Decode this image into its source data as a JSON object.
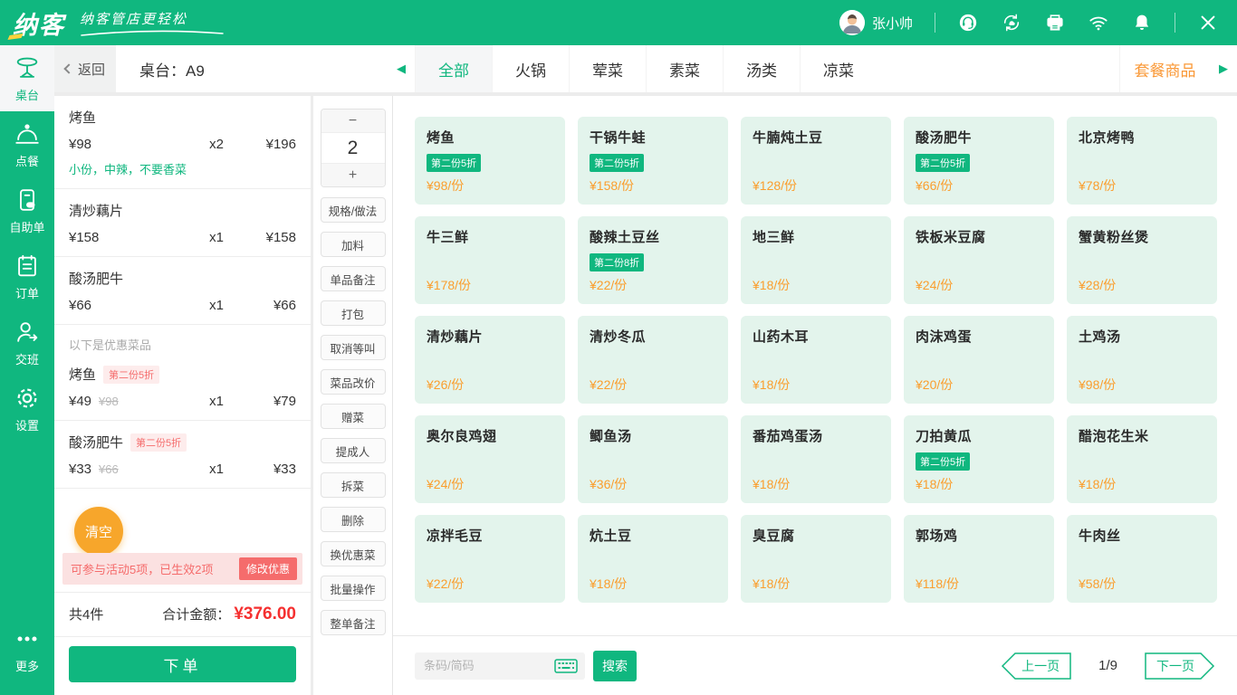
{
  "colors": {
    "brand_green": "#10b77f",
    "card_mint": "#e3f4ec",
    "price_orange": "#fa9e2e",
    "combo_orange": "#fa9836",
    "clear_orange": "#f7a62b",
    "danger_red": "#f53030",
    "promo_red": "#f56c6c",
    "promo_bg": "#fbe1e1"
  },
  "topbar": {
    "logo_text": "纳客",
    "slogan": "纳客管店更轻松",
    "user_name": "张小帅",
    "icon_names": [
      "support-icon",
      "sync-icon",
      "printer-icon",
      "wifi-icon",
      "bell-icon",
      "close-icon"
    ]
  },
  "sidebar": {
    "items": [
      {
        "key": "table",
        "icon": "table-icon",
        "label": "桌台",
        "active": true
      },
      {
        "key": "order-food",
        "icon": "dish-icon",
        "label": "点餐",
        "active": false
      },
      {
        "key": "self-order",
        "icon": "self-order-icon",
        "label": "自助单",
        "active": false
      },
      {
        "key": "orders",
        "icon": "order-list-icon",
        "label": "订单",
        "active": false
      },
      {
        "key": "shift",
        "icon": "shift-icon",
        "label": "交班",
        "active": false
      },
      {
        "key": "settings",
        "icon": "gear-icon",
        "label": "设置",
        "active": false
      }
    ],
    "more": {
      "key": "more",
      "icon": "more-dots-icon",
      "label": "更多"
    }
  },
  "header": {
    "back_label": "返回",
    "table_label": "桌台：A9",
    "tabs": [
      {
        "label": "全部",
        "active": true
      },
      {
        "label": "火锅",
        "active": false
      },
      {
        "label": "荤菜",
        "active": false
      },
      {
        "label": "素菜",
        "active": false
      },
      {
        "label": "汤类",
        "active": false
      },
      {
        "label": "凉菜",
        "active": false
      }
    ],
    "combo_label": "套餐商品",
    "scroll_left_icon": "◀",
    "scroll_right_icon": "▶"
  },
  "cart": {
    "items": [
      {
        "name": "烤鱼",
        "price": "¥98",
        "qty": "x2",
        "total": "¥196",
        "note": "小份，中辣，不要香菜"
      },
      {
        "name": "清炒藕片",
        "price": "¥158",
        "qty": "x1",
        "total": "¥158"
      },
      {
        "name": "酸汤肥牛",
        "price": "¥66",
        "qty": "x1",
        "total": "¥66"
      }
    ],
    "discount_section_label": "以下是优惠菜品",
    "discount_items": [
      {
        "name": "烤鱼",
        "badge": "第二份5折",
        "price": "¥49",
        "orig_price": "¥98",
        "qty": "x1",
        "total": "¥79"
      },
      {
        "name": "酸汤肥牛",
        "badge": "第二份5折",
        "price": "¥33",
        "orig_price": "¥66",
        "qty": "x1",
        "total": "¥33"
      }
    ],
    "clear_label": "清空",
    "promo_text": "可参与活动5项，已生效2项",
    "promo_button": "修改优惠",
    "count_label": "共4件",
    "total_label": "合计金额：",
    "total_value": "¥376.00",
    "submit_label": "下单"
  },
  "actions": {
    "minus_label": "−",
    "qty_value": "2",
    "plus_label": "+",
    "buttons": [
      "规格/做法",
      "加料",
      "单品备注",
      "打包",
      "取消等叫",
      "菜品改价",
      "赠菜",
      "提成人",
      "拆菜",
      "删除",
      "换优惠菜",
      "批量操作",
      "整单备注"
    ]
  },
  "menu": {
    "items": [
      {
        "name": "烤鱼",
        "badge": "第二份5折",
        "price": "¥98/份"
      },
      {
        "name": "干锅牛蛙",
        "badge": "第二份5折",
        "price": "¥158/份"
      },
      {
        "name": "牛腩炖土豆",
        "badge": "",
        "price": "¥128/份"
      },
      {
        "name": "酸汤肥牛",
        "badge": "第二份5折",
        "price": "¥66/份"
      },
      {
        "name": "北京烤鸭",
        "badge": "",
        "price": "¥78/份"
      },
      {
        "name": "牛三鲜",
        "badge": "",
        "price": "¥178/份"
      },
      {
        "name": "酸辣土豆丝",
        "badge": "第二份8折",
        "price": "¥22/份"
      },
      {
        "name": "地三鲜",
        "badge": "",
        "price": "¥18/份"
      },
      {
        "name": "铁板米豆腐",
        "badge": "",
        "price": "¥24/份"
      },
      {
        "name": "蟹黄粉丝煲",
        "badge": "",
        "price": "¥28/份"
      },
      {
        "name": "清炒藕片",
        "badge": "",
        "price": "¥26/份"
      },
      {
        "name": "清炒冬瓜",
        "badge": "",
        "price": "¥22/份"
      },
      {
        "name": "山药木耳",
        "badge": "",
        "price": "¥18/份"
      },
      {
        "name": "肉沫鸡蛋",
        "badge": "",
        "price": "¥20/份"
      },
      {
        "name": "土鸡汤",
        "badge": "",
        "price": "¥98/份"
      },
      {
        "name": "奥尔良鸡翅",
        "badge": "",
        "price": "¥24/份"
      },
      {
        "name": "鲫鱼汤",
        "badge": "",
        "price": "¥36/份"
      },
      {
        "name": "番茄鸡蛋汤",
        "badge": "",
        "price": "¥18/份"
      },
      {
        "name": "刀拍黄瓜",
        "badge": "第二份5折",
        "price": "¥18/份"
      },
      {
        "name": "醋泡花生米",
        "badge": "",
        "price": "¥18/份"
      },
      {
        "name": "凉拌毛豆",
        "badge": "",
        "price": "¥22/份"
      },
      {
        "name": "炕土豆",
        "badge": "",
        "price": "¥18/份"
      },
      {
        "name": "臭豆腐",
        "badge": "",
        "price": "¥18/份"
      },
      {
        "name": "郭场鸡",
        "badge": "",
        "price": "¥118/份"
      },
      {
        "name": "牛肉丝",
        "badge": "",
        "price": "¥58/份"
      }
    ]
  },
  "footer": {
    "search_placeholder": "条码/简码",
    "search_label": "搜索",
    "prev_label": "上一页",
    "page": "1/9",
    "next_label": "下一页"
  }
}
